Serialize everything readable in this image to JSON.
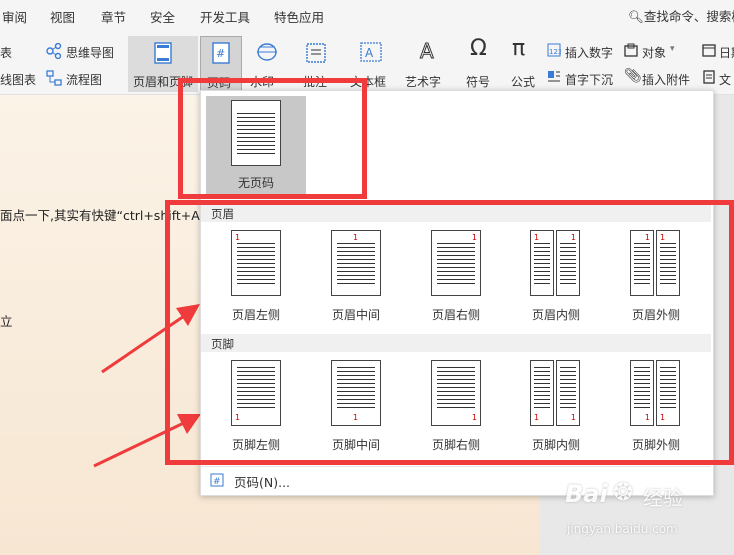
{
  "menubar": {
    "items": [
      "审阅",
      "视图",
      "章节",
      "安全",
      "开发工具",
      "特色应用"
    ],
    "search_text": "查找命令、搜索模"
  },
  "ribbon": {
    "left_top": "表",
    "left_bottom": "线图表",
    "mindmap": "思维导图",
    "flowchart": "流程图",
    "header_footer": "页眉和页脚",
    "page_number": "页码",
    "watermark": "水印",
    "comment": "批注",
    "textbox": "文本框",
    "arttext": "艺术字",
    "symbol": "符号",
    "formula": "公式",
    "insert_number": "插入数字",
    "drop_cap": "首字下沉",
    "object": "对象",
    "attachment": "插入附件",
    "date": "日期",
    "doc_part": "文"
  },
  "document": {
    "line1": "面点一下,其实有快键“ctrl+shift+A",
    "line2": "立"
  },
  "dropdown": {
    "no_page_number": "无页码",
    "header_section": "页眉",
    "footer_section": "页脚",
    "header_options": [
      "页眉左侧",
      "页眉中间",
      "页眉右侧",
      "页眉内侧",
      "页眉外侧"
    ],
    "footer_options": [
      "页脚左侧",
      "页脚中间",
      "页脚右侧",
      "页脚内侧",
      "页脚外侧"
    ],
    "page_number_link": "页码(N)...",
    "sample_number": "1"
  },
  "watermark_logo": {
    "brand": "Bai",
    "brand2": "经验",
    "url": "jingyan.baidu.com"
  },
  "colors": {
    "annotation_red": "#ef3b3b",
    "selected_gray": "#c8c8c8"
  }
}
